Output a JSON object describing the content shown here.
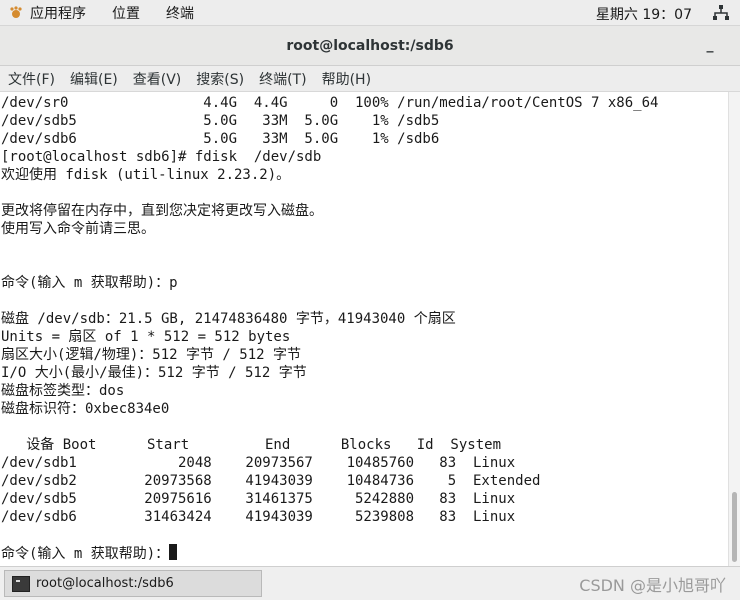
{
  "topbar": {
    "applications": "应用程序",
    "places": "位置",
    "terminal": "终端",
    "clock": "星期六 19：07"
  },
  "window": {
    "title": "root@localhost:/sdb6",
    "minimize": "_"
  },
  "menubar": {
    "file": "文件(F)",
    "edit": "编辑(E)",
    "view": "查看(V)",
    "search": "搜索(S)",
    "terminal": "终端(T)",
    "help": "帮助(H)"
  },
  "terminal": {
    "lines": [
      "/dev/sr0                4.4G  4.4G     0  100% /run/media/root/CentOS 7 x86_64",
      "/dev/sdb5               5.0G   33M  5.0G    1% /sdb5",
      "/dev/sdb6               5.0G   33M  5.0G    1% /sdb6",
      "[root@localhost sdb6]# fdisk  /dev/sdb",
      "欢迎使用 fdisk (util-linux 2.23.2)。",
      "",
      "更改将停留在内存中，直到您决定将更改写入磁盘。",
      "使用写入命令前请三思。",
      "",
      "",
      "命令(输入 m 获取帮助)：p",
      "",
      "磁盘 /dev/sdb：21.5 GB, 21474836480 字节，41943040 个扇区",
      "Units = 扇区 of 1 * 512 = 512 bytes",
      "扇区大小(逻辑/物理)：512 字节 / 512 字节",
      "I/O 大小(最小/最佳)：512 字节 / 512 字节",
      "磁盘标签类型：dos",
      "磁盘标识符：0xbec834e0",
      "",
      "   设备 Boot      Start         End      Blocks   Id  System",
      "/dev/sdb1            2048    20973567    10485760   83  Linux",
      "/dev/sdb2        20973568    41943039    10484736    5  Extended",
      "/dev/sdb5        20975616    31461375     5242880   83  Linux",
      "/dev/sdb6        31463424    41943039     5239808   83  Linux",
      ""
    ],
    "prompt": "命令(输入 m 获取帮助)："
  },
  "taskbar": {
    "task_label": "root@localhost:/sdb6",
    "watermark": "CSDN @是小旭哥吖"
  }
}
